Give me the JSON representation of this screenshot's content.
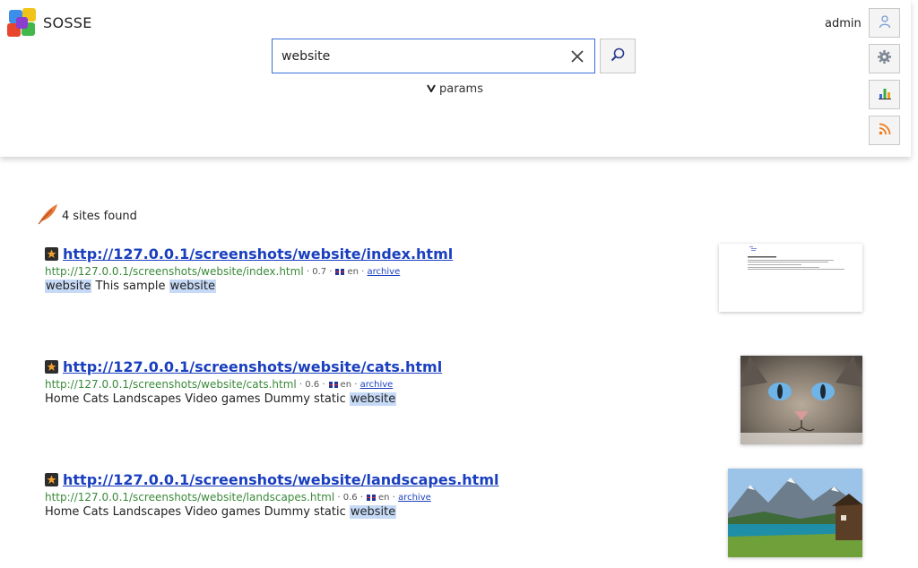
{
  "app": {
    "name": "SOSSE"
  },
  "search": {
    "query": "website",
    "params_label": "params"
  },
  "user": {
    "name": "admin"
  },
  "results_summary": {
    "count": "4",
    "label": "sites found"
  },
  "results": [
    {
      "title": "http://127.0.0.1/screenshots/website/index.html",
      "url": "http://127.0.0.1/screenshots/website/index.html",
      "score": "0.7",
      "lang": "en",
      "archive_label": "archive",
      "snippet": [
        {
          "text": "website",
          "hl": true
        },
        {
          "text": " This sample ",
          "hl": false
        },
        {
          "text": "website",
          "hl": true
        }
      ],
      "thumb_title": "Dummy static website"
    },
    {
      "title": "http://127.0.0.1/screenshots/website/cats.html",
      "url": "http://127.0.0.1/screenshots/website/cats.html",
      "score": "0.6",
      "lang": "en",
      "archive_label": "archive",
      "snippet": [
        {
          "text": "Home Cats Landscapes Video games Dummy static ",
          "hl": false
        },
        {
          "text": "website",
          "hl": true
        }
      ]
    },
    {
      "title": "http://127.0.0.1/screenshots/website/landscapes.html",
      "url": "http://127.0.0.1/screenshots/website/landscapes.html",
      "score": "0.6",
      "lang": "en",
      "archive_label": "archive",
      "snippet": [
        {
          "text": "Home Cats Landscapes Video games Dummy static ",
          "hl": false
        },
        {
          "text": "website",
          "hl": true
        }
      ]
    }
  ],
  "colors": {
    "link": "#1a3fbf",
    "url": "#3a8a3a",
    "highlight": "#c6daf7",
    "accent": "#3b6fd6"
  },
  "icons": {
    "logo": "sosse-logo-icon",
    "clear": "close-icon",
    "search": "search-icon",
    "params": "chevron-down-icon",
    "profile": "user-icon",
    "settings": "gear-icon",
    "stats": "bar-chart-icon",
    "rss": "rss-icon",
    "found": "feather-icon",
    "favicon": "star-icon"
  }
}
